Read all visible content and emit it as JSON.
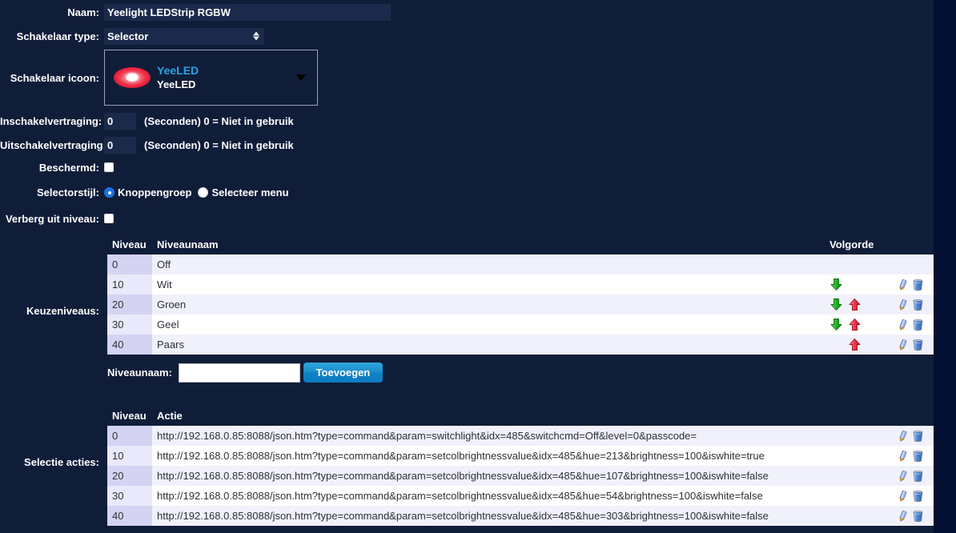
{
  "theme": {
    "page_bg": "#101d39",
    "strip_bg": "#020f32",
    "input_bg": "#1b2a4b",
    "accent_blue": "#2aa3e0",
    "button_blue": "#1b8ccb",
    "row_odd": "#f1f1fb",
    "row_even": "#ffffff",
    "level_cell_odd": "#d4d3f2",
    "level_cell_even": "#eae9fb"
  },
  "form": {
    "name": {
      "label": "Naam:",
      "value": "Yeelight LEDStrip RGBW",
      "placeholder": ""
    },
    "switch_type": {
      "label": "Schakelaar type:",
      "value": "Selector",
      "options": [
        "Selector"
      ]
    },
    "switch_icon": {
      "label": "Schakelaar icoon:",
      "title": "YeeLED",
      "subtitle": "YeeLED",
      "icon": "yeeled-ring-icon",
      "caret": "chevron-down-icon"
    },
    "switch_on_delay": {
      "label": "Inschakelvertraging:",
      "value": "0",
      "hint": "(Seconden) 0 = Niet in gebruik"
    },
    "switch_off_delay": {
      "label": "Uitschakelvertraging:",
      "value": "0",
      "hint": "(Seconden) 0 = Niet in gebruik"
    },
    "protected": {
      "label": "Beschermd:",
      "checked": false
    },
    "selector_style": {
      "label": "Selectorstijl:",
      "options": [
        {
          "label": "Knoppengroep",
          "checked": true
        },
        {
          "label": "Selecteer menu",
          "checked": false
        }
      ]
    },
    "hide_off_level": {
      "label": "Verberg uit niveau:",
      "checked": false
    }
  },
  "levels": {
    "side_label": "Keuzeniveaus:",
    "headers": {
      "level": "Niveau",
      "name": "Niveaunaam",
      "order": "Volgorde",
      "actions": ""
    },
    "rows": [
      {
        "level": "0",
        "name": "Off",
        "down": false,
        "up": false
      },
      {
        "level": "10",
        "name": "Wit",
        "down": true,
        "up": false
      },
      {
        "level": "20",
        "name": "Groen",
        "down": true,
        "up": true
      },
      {
        "level": "30",
        "name": "Geel",
        "down": true,
        "up": true
      },
      {
        "level": "40",
        "name": "Paars",
        "down": false,
        "up": true
      }
    ],
    "icons": {
      "down": "arrow-down-green-icon",
      "up": "arrow-up-red-icon",
      "edit": "pencil-edit-icon",
      "delete": "trash-delete-icon"
    }
  },
  "add_level": {
    "label": "Niveaunaam:",
    "value": "",
    "placeholder": "",
    "button": "Toevoegen"
  },
  "actions": {
    "side_label": "Selectie acties:",
    "headers": {
      "level": "Niveau",
      "action": "Actie"
    },
    "rows": [
      {
        "level": "0",
        "action": "http://192.168.0.85:8088/json.htm?type=command&param=switchlight&idx=485&switchcmd=Off&level=0&passcode="
      },
      {
        "level": "10",
        "action": "http://192.168.0.85:8088/json.htm?type=command&param=setcolbrightnessvalue&idx=485&hue=213&brightness=100&iswhite=true"
      },
      {
        "level": "20",
        "action": "http://192.168.0.85:8088/json.htm?type=command&param=setcolbrightnessvalue&idx=485&hue=107&brightness=100&iswhite=false"
      },
      {
        "level": "30",
        "action": "http://192.168.0.85:8088/json.htm?type=command&param=setcolbrightnessvalue&idx=485&hue=54&brightness=100&iswhite=false"
      },
      {
        "level": "40",
        "action": "http://192.168.0.85:8088/json.htm?type=command&param=setcolbrightnessvalue&idx=485&hue=303&brightness=100&iswhite=false"
      }
    ],
    "icons": {
      "edit": "pencil-edit-icon",
      "delete": "trash-delete-icon"
    }
  }
}
